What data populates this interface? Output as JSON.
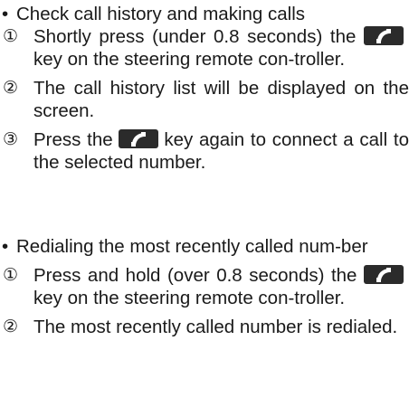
{
  "section1": {
    "bullet": "•",
    "heading": "Check call history and making calls",
    "steps": [
      {
        "num": "①",
        "before": "Shortly press (under 0.8 seconds) the",
        "after": "key on the steering remote con-troller."
      },
      {
        "num": "②",
        "text": "The call history list will be displayed on the screen."
      },
      {
        "num": "③",
        "before": "Press the",
        "after": "key again to connect a call to the selected number."
      }
    ]
  },
  "section2": {
    "bullet": "•",
    "heading": "Redialing the most recently called num-ber",
    "steps": [
      {
        "num": "①",
        "before": "Press and hold (over 0.8 seconds) the",
        "after": "key on the steering remote con-troller."
      },
      {
        "num": "②",
        "text": "The most recently called number is redialed."
      }
    ]
  },
  "icons": {
    "call_key": "phone-handset-icon"
  }
}
